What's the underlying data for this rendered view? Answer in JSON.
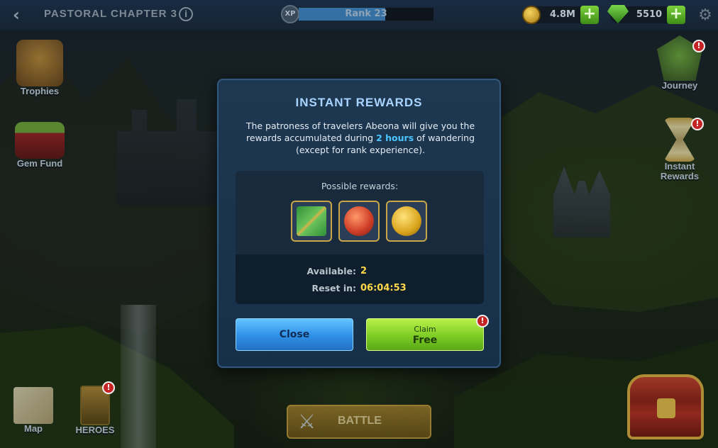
{
  "topbar": {
    "back_glyph": "‹",
    "chapter_title": "PASTORAL CHAPTER 3",
    "info_glyph": "i",
    "xp_icon_label": "XP",
    "rank_label": "Rank 23",
    "rank_progress": 0.64,
    "gold_value": "4.8M",
    "gems_value": "5510",
    "plus_glyph": "+",
    "settings_glyph": "⚙"
  },
  "side_left": [
    {
      "label": "Trophies"
    },
    {
      "label": "Gem Fund"
    }
  ],
  "side_right": [
    {
      "label": "Journey",
      "badge": "!"
    },
    {
      "label_line1": "Instant",
      "label_line2": "Rewards",
      "badge": "!"
    }
  ],
  "bottom": {
    "map_label": "Map",
    "heroes_label": "HEROES",
    "heroes_badge": "!",
    "battle_label": "BATTLE",
    "battle_icon": "crossed-swords-icon"
  },
  "modal": {
    "title": "INSTANT REWARDS",
    "desc_part1": "The patroness of travelers Abeona will give you the rewards accumulated during ",
    "desc_highlight": "2 hours",
    "desc_part2": " of wandering (except for rank experience).",
    "rewards_title": "Possible rewards:",
    "rewards": [
      {
        "icon": "scroll-icon"
      },
      {
        "icon": "red-orb-icon"
      },
      {
        "icon": "gold-coin-icon"
      }
    ],
    "available_label": "Available:",
    "available_value": "2",
    "reset_label": "Reset in:",
    "reset_value": "06:04:53",
    "close_label": "Close",
    "claim_top": "Claim",
    "claim_bottom": "Free",
    "claim_badge": "!"
  },
  "colors": {
    "modal_bg": "#17304a",
    "title": "#a9d4ff",
    "highlight": "#4cc6ff",
    "value": "#ffd84a",
    "close_btn": "#2f8fe6",
    "claim_btn": "#7ccd24"
  }
}
